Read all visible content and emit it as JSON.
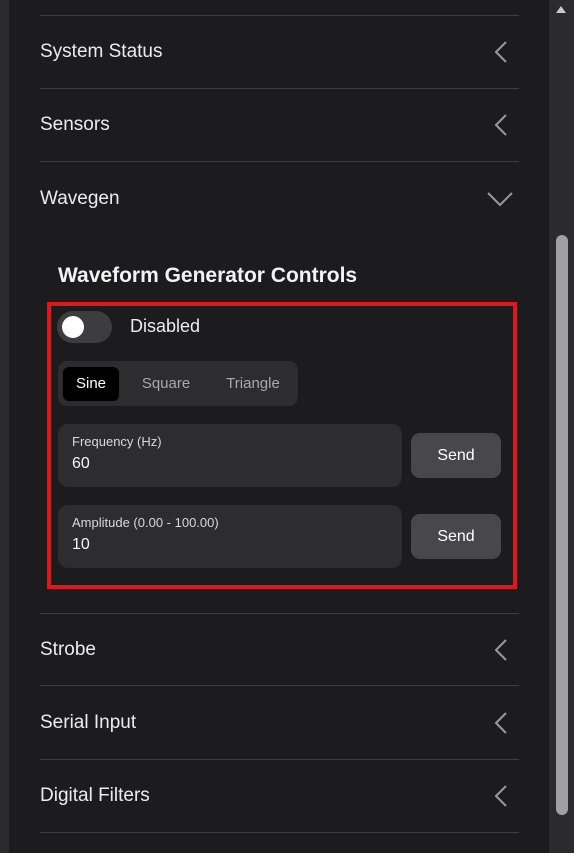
{
  "accordion": {
    "items": [
      {
        "label": "System Status",
        "expanded": false,
        "icon": "chevron-left-icon"
      },
      {
        "label": "Sensors",
        "expanded": false,
        "icon": "chevron-left-icon"
      },
      {
        "label": "Wavegen",
        "expanded": true,
        "icon": "chevron-down-icon"
      },
      {
        "label": "Strobe",
        "expanded": false,
        "icon": "chevron-left-icon"
      },
      {
        "label": "Serial Input",
        "expanded": false,
        "icon": "chevron-left-icon"
      },
      {
        "label": "Digital Filters",
        "expanded": false,
        "icon": "chevron-left-icon"
      }
    ]
  },
  "wavegen": {
    "title": "Waveform Generator Controls",
    "toggle": {
      "label": "Disabled",
      "enabled": false
    },
    "waveforms": [
      {
        "label": "Sine",
        "active": true
      },
      {
        "label": "Square",
        "active": false
      },
      {
        "label": "Triangle",
        "active": false
      }
    ],
    "frequency": {
      "label": "Frequency (Hz)",
      "value": "60",
      "send_label": "Send"
    },
    "amplitude": {
      "label": "Amplitude (0.00 - 100.00)",
      "value": "10",
      "send_label": "Send"
    }
  },
  "colors": {
    "background": "#1c1c1e",
    "highlight": "#e3161b",
    "field": "#2d2d30",
    "button": "#48484c"
  }
}
